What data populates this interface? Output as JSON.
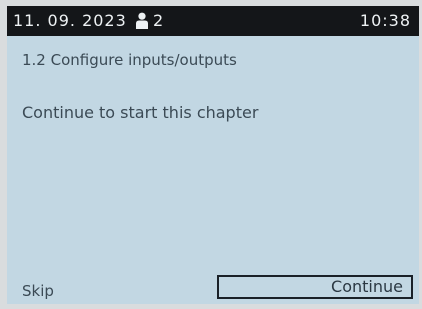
{
  "status_bar": {
    "date": "11. 09. 2023",
    "user_count": "2",
    "time": "10:38"
  },
  "content": {
    "chapter_title": "1.2 Configure inputs/outputs",
    "message": "Continue to start this chapter"
  },
  "footer": {
    "skip_label": "Skip",
    "continue_label": "Continue"
  },
  "icons": {
    "user": "person-icon"
  }
}
